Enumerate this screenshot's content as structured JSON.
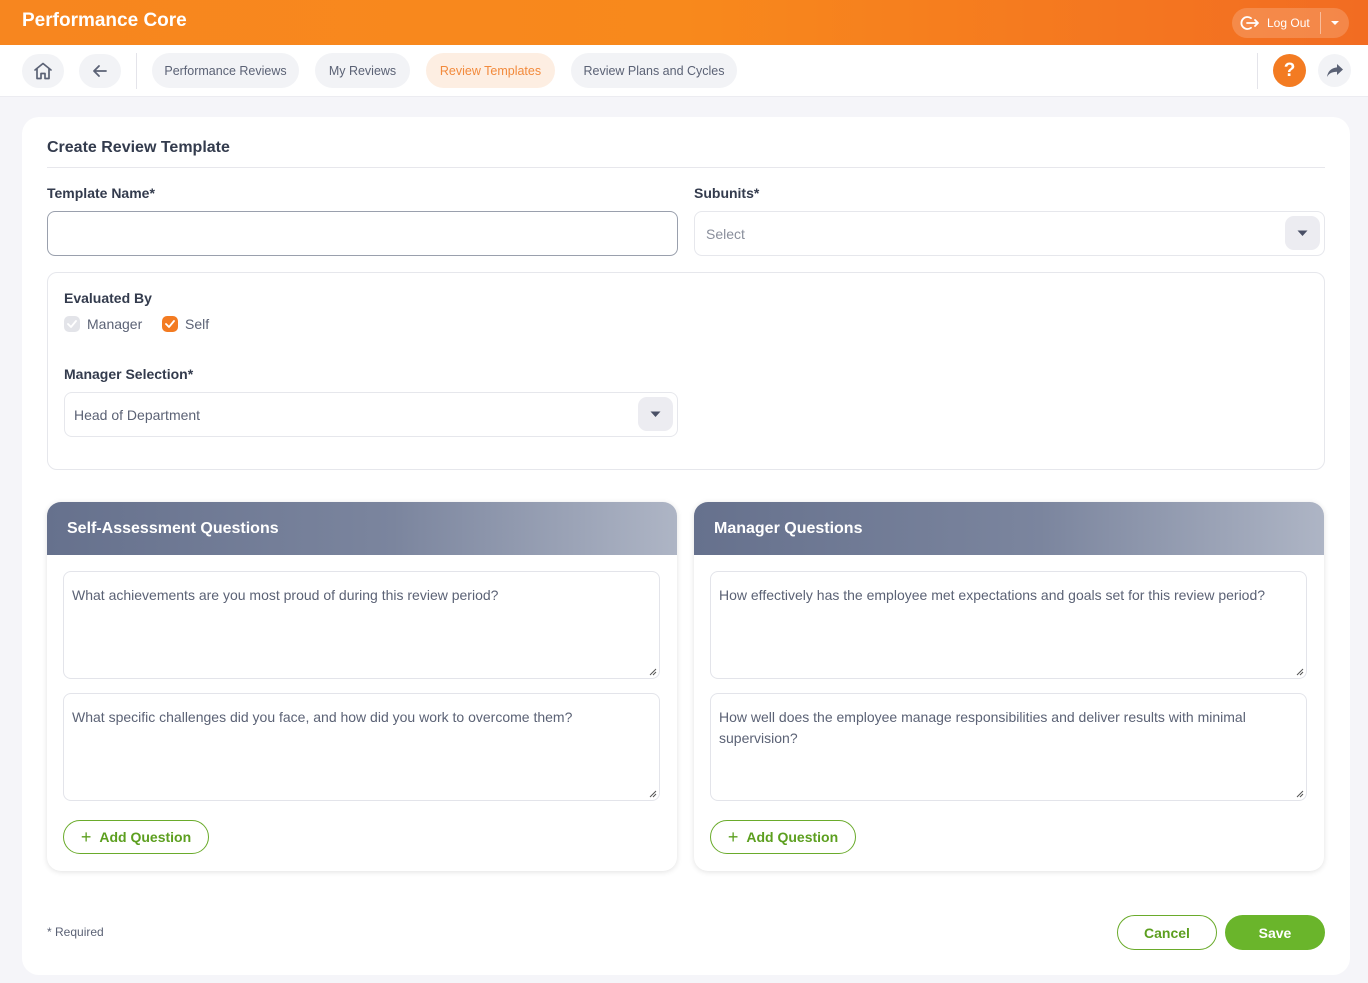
{
  "app": {
    "title": "Performance Core"
  },
  "header": {
    "logout_label": "Log Out"
  },
  "nav": {
    "tabs": [
      {
        "label": "Performance Reviews",
        "active": false
      },
      {
        "label": "My Reviews",
        "active": false
      },
      {
        "label": "Review Templates",
        "active": true
      },
      {
        "label": "Review Plans and Cycles",
        "active": false
      }
    ],
    "help_label": "?"
  },
  "form": {
    "title": "Create Review Template",
    "template_name": {
      "label": "Template Name*",
      "value": ""
    },
    "subunits": {
      "label": "Subunits*",
      "placeholder": "Select"
    },
    "evaluated_by": {
      "label": "Evaluated By",
      "options": [
        {
          "label": "Manager",
          "checked": false
        },
        {
          "label": "Self",
          "checked": true
        }
      ]
    },
    "manager_selection": {
      "label": "Manager Selection*",
      "value": "Head of Department"
    }
  },
  "self_assessment": {
    "title": "Self-Assessment Questions",
    "questions": [
      "What achievements are you most proud of during this review period?",
      "What specific challenges did you face, and how did you work to overcome them?"
    ],
    "add_label": "Add Question"
  },
  "manager_questions": {
    "title": "Manager Questions",
    "questions": [
      "How effectively has the employee met expectations and goals set for this review period?",
      "How well does the employee manage responsibilities and deliver results with minimal supervision?"
    ],
    "add_label": "Add Question"
  },
  "footer": {
    "required_note": "* Required",
    "cancel_label": "Cancel",
    "save_label": "Save"
  },
  "colors": {
    "brand_orange": "#f7861f",
    "accent_green": "#6ab52b",
    "panel_header": "#66718d"
  }
}
